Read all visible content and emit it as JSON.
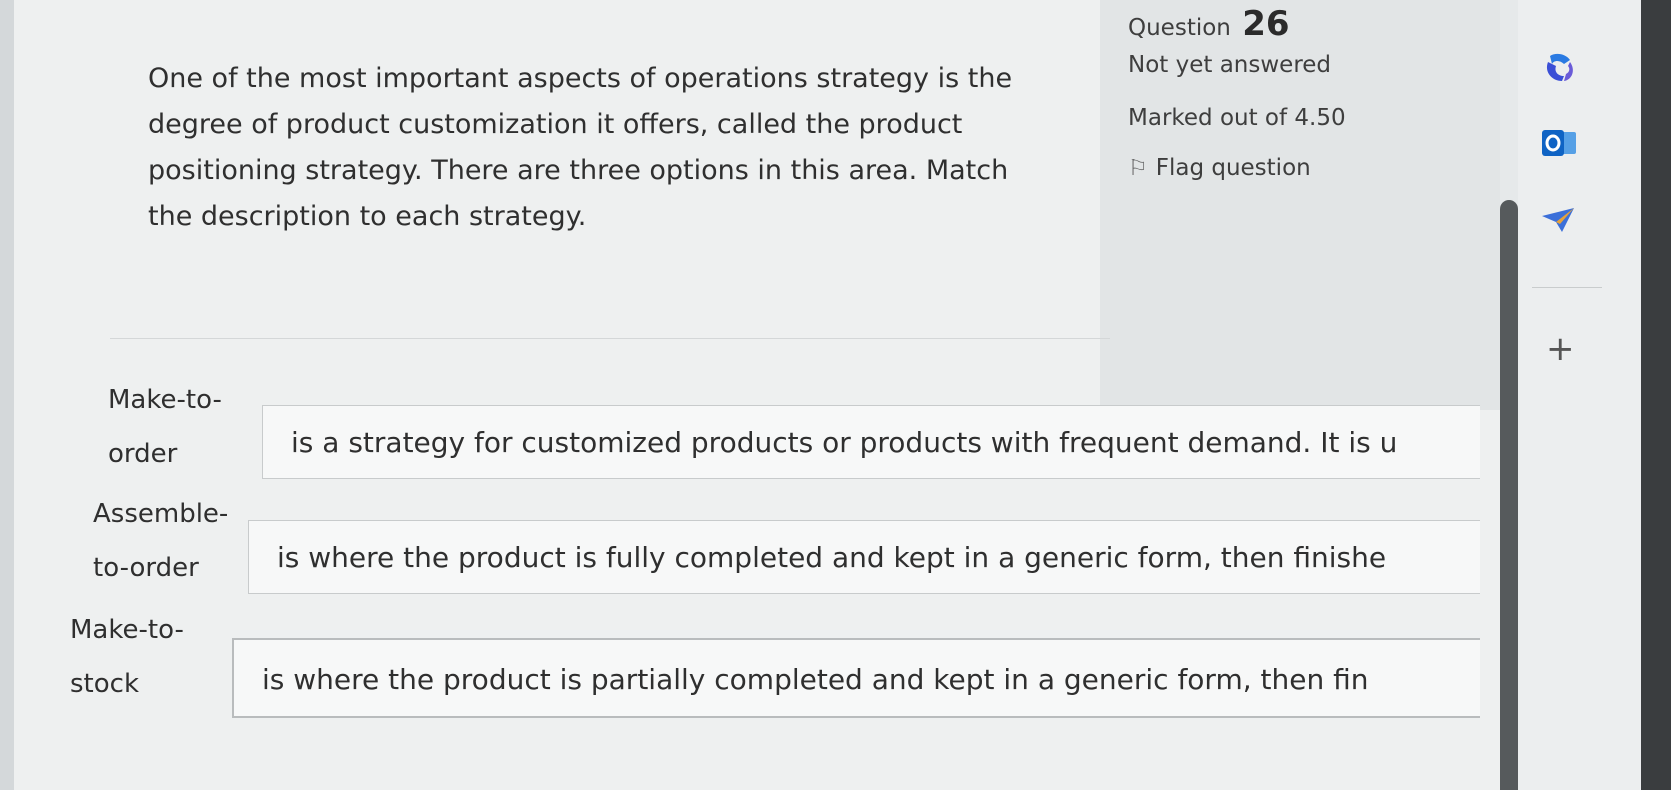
{
  "question": {
    "label": "Question",
    "number": "26",
    "status": "Not yet answered",
    "marks": "Marked out of 4.50",
    "flag_label": "Flag question",
    "text": "One of the most important aspects of operations strategy is the degree of product customization it offers, called the product positioning strategy. There are three options in this area. Match the description to each strategy."
  },
  "matches": [
    {
      "term": "Make-to-order",
      "selected": "is a strategy for customized products or products with frequent demand. It is u"
    },
    {
      "term": "Assemble-to-order",
      "selected": "is where the product is fully completed and kept in a generic form, then finishe"
    },
    {
      "term": "Make-to-stock",
      "selected": "is where the product is partially completed and kept in a generic form, then fin"
    }
  ],
  "sidebar": {
    "icons": [
      "copilot-icon",
      "outlook-icon",
      "send-icon",
      "plus-icon"
    ],
    "plus_symbol": "+"
  }
}
